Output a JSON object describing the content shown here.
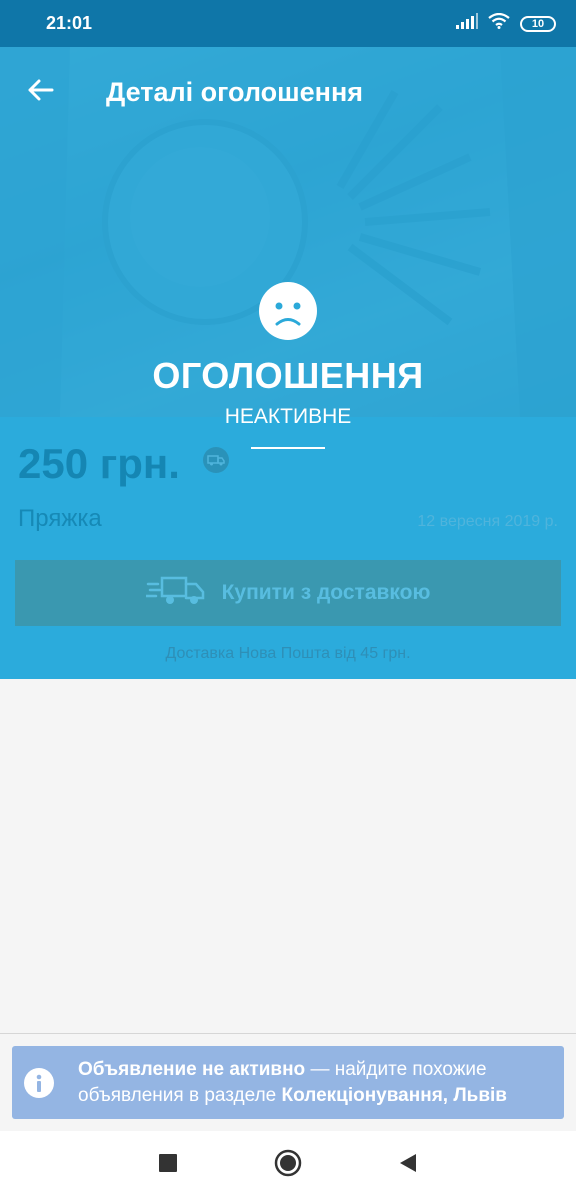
{
  "status_bar": {
    "time": "21:01",
    "battery": "10",
    "icons": [
      "signal-icon",
      "wifi-icon",
      "battery-icon"
    ]
  },
  "toolbar": {
    "title": "Деталі оголошення",
    "back_icon": "arrow-left-icon"
  },
  "inactive": {
    "icon": "sad-face-icon",
    "title": "ОГОЛОШЕННЯ",
    "subtitle": "НЕАКТИВНЕ"
  },
  "listing": {
    "price": "250 грн.",
    "title": "Пряжка",
    "date": "12 вересня 2019 р.",
    "delivery_badge_icon": "delivery-truck-icon"
  },
  "buy": {
    "label": "Купити з доставкою",
    "icon": "fast-delivery-truck-icon",
    "note": "Доставка Нова Пошта від 45 грн."
  },
  "banner": {
    "icon": "info-icon",
    "bold_part": "Объявление не активно",
    "text_part": " — найдите похожие объявления в разделе ",
    "category": "Колекціонування, Львів"
  },
  "nav": {
    "icons": [
      "recent-apps-icon",
      "home-icon",
      "back-icon"
    ]
  },
  "colors": {
    "status_bar": "#0f76a8",
    "overlay": "#29aadc",
    "banner": "#94b5e3"
  }
}
